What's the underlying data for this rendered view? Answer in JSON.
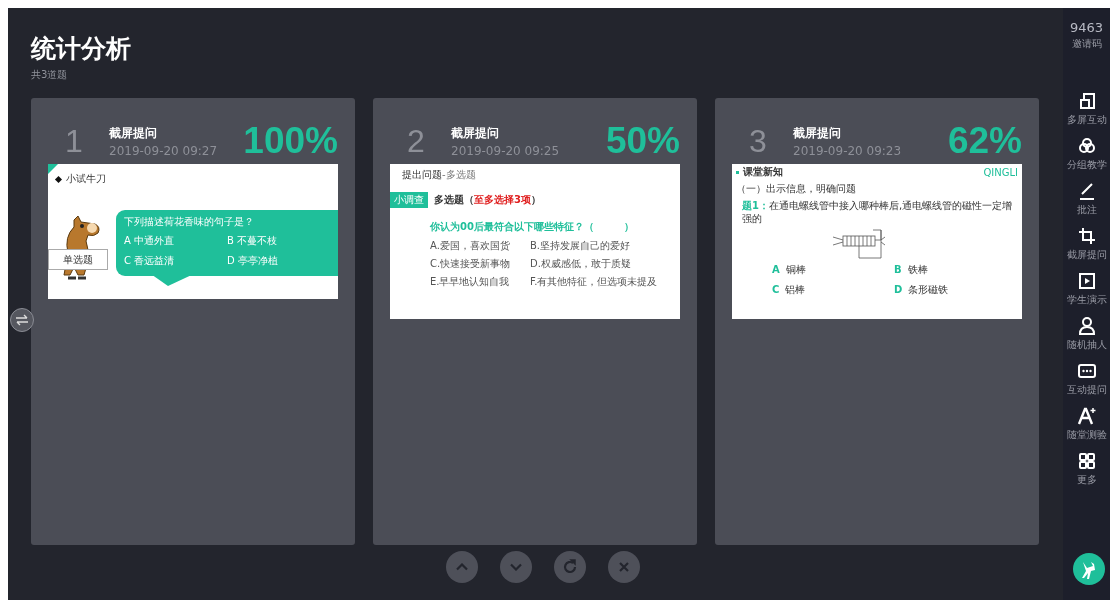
{
  "title": "统计分析",
  "subtitle": "共3道题",
  "cards": [
    {
      "number": "1",
      "title": "截屏提问",
      "time": "2019-09-20 09:27",
      "percent": "100%",
      "slide": {
        "kind": "bubble",
        "header": "小试牛刀",
        "tag": "单选题",
        "question": "下列描述荷花香味的句子是？",
        "options": [
          {
            "letter": "A",
            "text": "中通外直"
          },
          {
            "letter": "B",
            "text": "不蔓不枝"
          },
          {
            "letter": "C",
            "text": "香远益清"
          },
          {
            "letter": "D",
            "text": "亭亭净植"
          }
        ]
      }
    },
    {
      "number": "2",
      "title": "截屏提问",
      "time": "2019-09-20 09:25",
      "percent": "50%",
      "slide": {
        "kind": "survey",
        "header": "提出问题",
        "header_note": "-多选题",
        "badge": "小调查",
        "heading": "多选题（**至多选择3项**）",
        "question": "你认为00后最符合以下哪些特征？（　　　）",
        "options": [
          "A.爱国，喜欢国货",
          "B.坚持发展自己的爱好",
          "C.快速接受新事物",
          "D.权威感低，敢于质疑",
          "E.早早地认知自我",
          "F.有其他特征，但选项未提及"
        ]
      }
    },
    {
      "number": "3",
      "title": "截屏提问",
      "time": "2019-09-20 09:23",
      "percent": "62%",
      "slide": {
        "kind": "diagram",
        "header": "课堂新知",
        "logo": "QINGLI",
        "section": "（一）出示信息，明确问题",
        "label": "题1：",
        "question": "在通电螺线管中接入哪种棒后,通电螺线管的磁性一定增强的",
        "options": [
          {
            "letter": "A",
            "text": "铜棒"
          },
          {
            "letter": "B",
            "text": "铁棒"
          },
          {
            "letter": "C",
            "text": "铝棒"
          },
          {
            "letter": "D",
            "text": "条形磁铁"
          }
        ]
      }
    }
  ],
  "sidebar": {
    "code": "9463",
    "code_label": "邀请码",
    "tools": [
      {
        "label": "多屏互动"
      },
      {
        "label": "分组教学"
      },
      {
        "label": "批注"
      },
      {
        "label": "截屏提问"
      },
      {
        "label": "学生演示"
      },
      {
        "label": "随机抽人"
      },
      {
        "label": "互动提问"
      },
      {
        "label": "随堂测验"
      },
      {
        "label": "更多"
      }
    ]
  }
}
